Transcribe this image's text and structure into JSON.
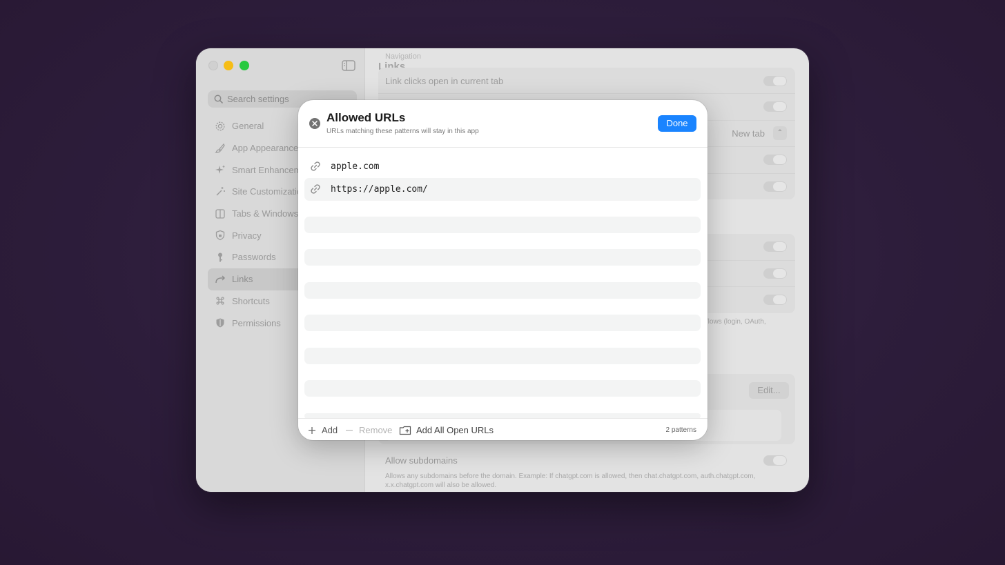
{
  "sidebar": {
    "search_placeholder": "Search settings",
    "items": [
      {
        "label": "General",
        "icon": "gear-icon"
      },
      {
        "label": "App Appearance",
        "icon": "paintbrush-icon"
      },
      {
        "label": "Smart Enhancements",
        "icon": "sparkles-icon"
      },
      {
        "label": "Site Customization",
        "icon": "magic-wand-icon"
      },
      {
        "label": "Tabs & Windows",
        "icon": "split-window-icon"
      },
      {
        "label": "Privacy",
        "icon": "shield-icon"
      },
      {
        "label": "Passwords",
        "icon": "key-icon"
      },
      {
        "label": "Links",
        "icon": "arrow-turn-icon",
        "active": true
      },
      {
        "label": "Shortcuts",
        "icon": "command-icon"
      },
      {
        "label": "Permissions",
        "icon": "badge-shield-icon"
      }
    ]
  },
  "main": {
    "title": "Links",
    "ghost_header": "Navigation",
    "rows": {
      "link_clicks": "Link clicks open in current tab",
      "new_tab_value": "New tab",
      "auth_desc_fragment": "tion flows (login, OAuth,",
      "edit_label": "Edit...",
      "subdomains_label": "Allow subdomains",
      "subdomains_desc": "Allows any subdomains before the domain. Example: If chatgpt.com is allowed, then chat.chatgpt.com, auth.chatgpt.com, x.x.chatgpt.com will also be allowed."
    }
  },
  "modal": {
    "title": "Allowed URLs",
    "subtitle": "URLs matching these patterns will stay in this app",
    "done_label": "Done",
    "urls": [
      "apple.com",
      "https://apple.com/"
    ],
    "footer": {
      "add_label": "Add",
      "remove_label": "Remove",
      "add_all_label": "Add All Open URLs",
      "count_label": "2 patterns"
    }
  },
  "colors": {
    "accent": "#1a84ff",
    "traffic_min": "#f6bd16",
    "traffic_max": "#27c93f",
    "backdrop": "#2d1d3b"
  }
}
